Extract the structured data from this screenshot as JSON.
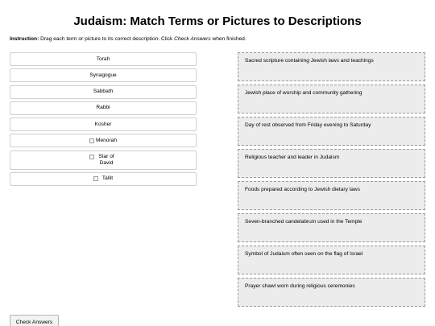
{
  "title": "Judaism: Match Terms or Pictures to Descriptions",
  "instruction": {
    "lead": "Instruction:",
    "text_before": " Drag each term or picture to its correct description. Click ",
    "emphasis": "Check Answers",
    "text_after": " when finished."
  },
  "terms": [
    {
      "label": "Torah"
    },
    {
      "label": "Synagogue"
    },
    {
      "label": "Sabbath"
    },
    {
      "label": "Rabbi"
    },
    {
      "label": "Kosher"
    },
    {
      "label": "Menorah",
      "icon": "broken-image-icon"
    },
    {
      "label": "Star of David",
      "icon": "broken-image-icon"
    },
    {
      "label": "Tallit",
      "icon": "broken-image-icon"
    }
  ],
  "descriptions": [
    "Sacred scripture containing Jewish laws and teachings",
    "Jewish place of worship and community gathering",
    "Day of rest observed from Friday evening to Saturday",
    "Religious teacher and leader in Judaism",
    "Foods prepared according to Jewish dietary laws",
    "Seven-branched candelabrum used in the Temple",
    "Symbol of Judaism often seen on the flag of Israel",
    "Prayer shawl worn during religious ceremonies"
  ],
  "check_button_label": "Check Answers",
  "colors": {
    "drop_zone_bg": "#ececec",
    "drop_zone_border": "#9a9a9a",
    "term_border": "#cfcfcf"
  }
}
